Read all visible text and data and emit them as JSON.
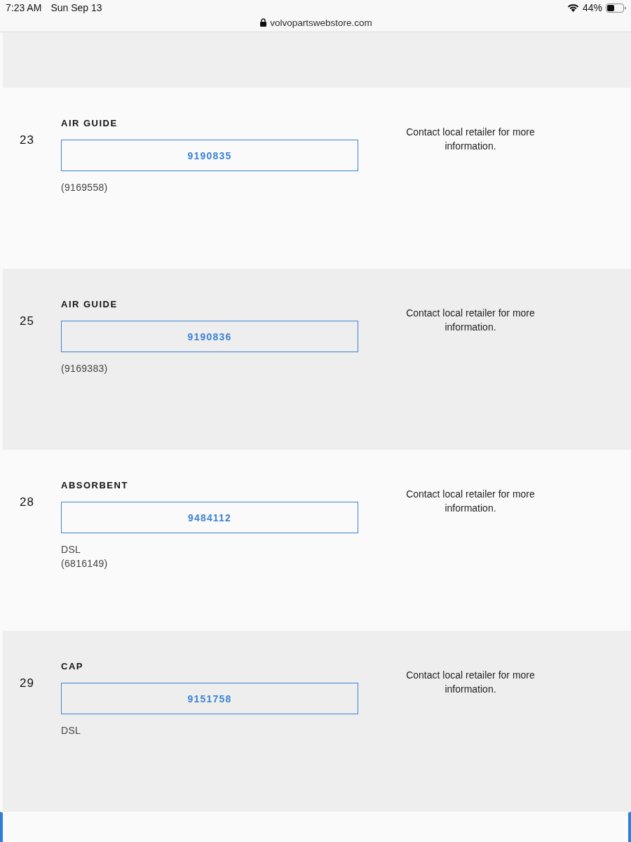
{
  "status_bar": {
    "time": "7:23 AM",
    "date": "Sun Sep 13",
    "battery": "44%"
  },
  "address_bar": {
    "url": "volvopartswebstore.com"
  },
  "parts": [
    {
      "number": "23",
      "name": "AIR GUIDE",
      "part_number": "9190835",
      "notes": [
        "(9169558)"
      ],
      "availability": "Contact local retailer for more information."
    },
    {
      "number": "25",
      "name": "AIR GUIDE",
      "part_number": "9190836",
      "notes": [
        "(9169383)"
      ],
      "availability": "Contact local retailer for more information."
    },
    {
      "number": "28",
      "name": "ABSORBENT",
      "part_number": "9484112",
      "notes": [
        "DSL",
        "(6816149)"
      ],
      "availability": "Contact local retailer for more information."
    },
    {
      "number": "29",
      "name": "CAP",
      "part_number": "9151758",
      "notes": [
        "DSL"
      ],
      "availability": "Contact local retailer for more information."
    }
  ]
}
